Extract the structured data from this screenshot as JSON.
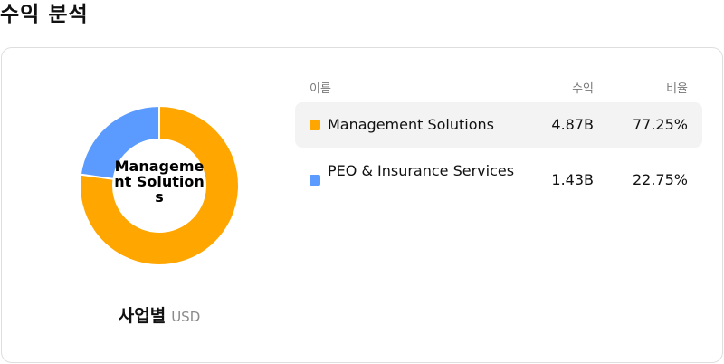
{
  "page": {
    "title": "수익 분석"
  },
  "chart": {
    "center_label": "Management Solutions",
    "caption": "사업별",
    "unit": "USD"
  },
  "table": {
    "headers": {
      "name": "이름",
      "revenue": "수익",
      "ratio": "비율"
    },
    "rows": [
      {
        "name": "Management Solutions",
        "revenue": "4.87B",
        "ratio": "77.25%",
        "color": "#FFA600"
      },
      {
        "name": "PEO & Insurance Services",
        "revenue": "1.43B",
        "ratio": "22.75%",
        "color": "#5B9BFF"
      }
    ]
  },
  "chart_data": {
    "type": "pie",
    "categories": [
      "Management Solutions",
      "PEO & Insurance Services"
    ],
    "values": [
      77.25,
      22.75
    ],
    "colors": [
      "#FFA600",
      "#5B9BFF"
    ],
    "title": "",
    "donut": true
  }
}
